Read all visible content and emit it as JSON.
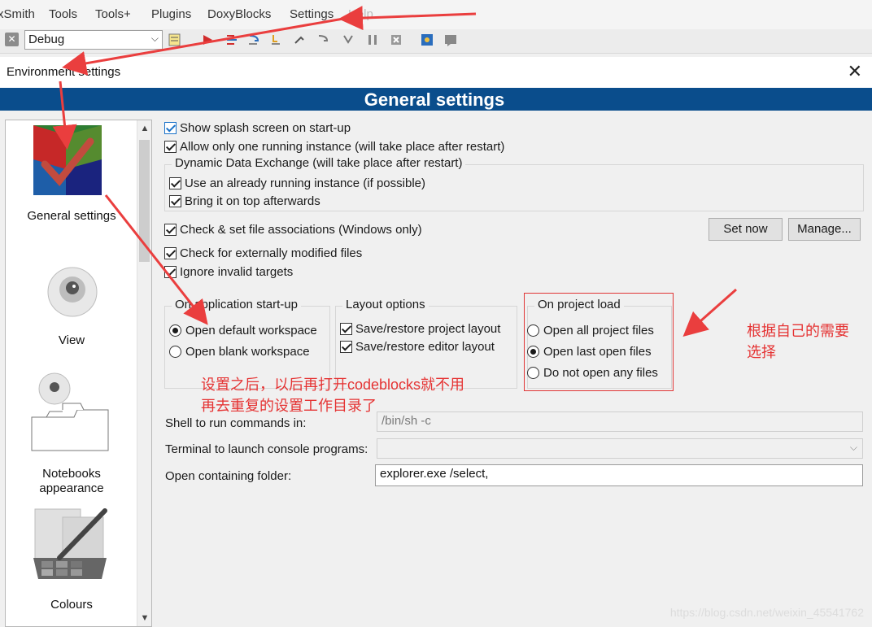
{
  "menubar": {
    "items": [
      "xSmith",
      "Tools",
      "Tools+",
      "Plugins",
      "DoxyBlocks",
      "Settings",
      "Help"
    ]
  },
  "toolbar": {
    "build_target": "Debug"
  },
  "dialog": {
    "title": "Environment settings",
    "header": "General settings",
    "left_panel": {
      "items": [
        "General settings",
        "View",
        "Notebooks appearance",
        "Colours"
      ]
    },
    "options": {
      "show_splash": "Show splash screen on start-up",
      "one_instance": "Allow only one running instance (will take place after restart)",
      "dde_group": "Dynamic Data Exchange (will take place after restart)",
      "use_running": "Use an already running instance (if possible)",
      "bring_on_top": "Bring it on top afterwards",
      "file_assoc": "Check & set file associations (Windows only)",
      "set_now": "Set now",
      "manage": "Manage...",
      "ext_modified": "Check for externally modified files",
      "ignore_invalid": "Ignore invalid targets"
    },
    "startup_group": {
      "label": "On application start-up",
      "open_default": "Open default workspace",
      "open_blank": "Open blank workspace"
    },
    "layout_group": {
      "label": "Layout options",
      "save_project": "Save/restore project layout",
      "save_editor": "Save/restore editor layout"
    },
    "project_load_group": {
      "label": "On project load",
      "open_all": "Open all project files",
      "open_last": "Open last open files",
      "do_not_open": "Do not open any files"
    },
    "fields": {
      "shell_label": "Shell to run commands in:",
      "shell_value": "/bin/sh -c",
      "terminal_label": "Terminal to launch console programs:",
      "terminal_value": "",
      "folder_label": "Open containing folder:",
      "folder_value": "explorer.exe /select,"
    }
  },
  "annotations": {
    "note_left_line1": "设置之后，以后再打开codeblocks就不用",
    "note_left_line2": "再去重复的设置工作目录了",
    "note_right_line1": "根据自己的需要",
    "note_right_line2": "选择"
  },
  "watermark": "https://blog.csdn.net/weixin_45541762",
  "colors": {
    "header_band": "#0a4d8c",
    "annotation_red": "#e53333"
  }
}
